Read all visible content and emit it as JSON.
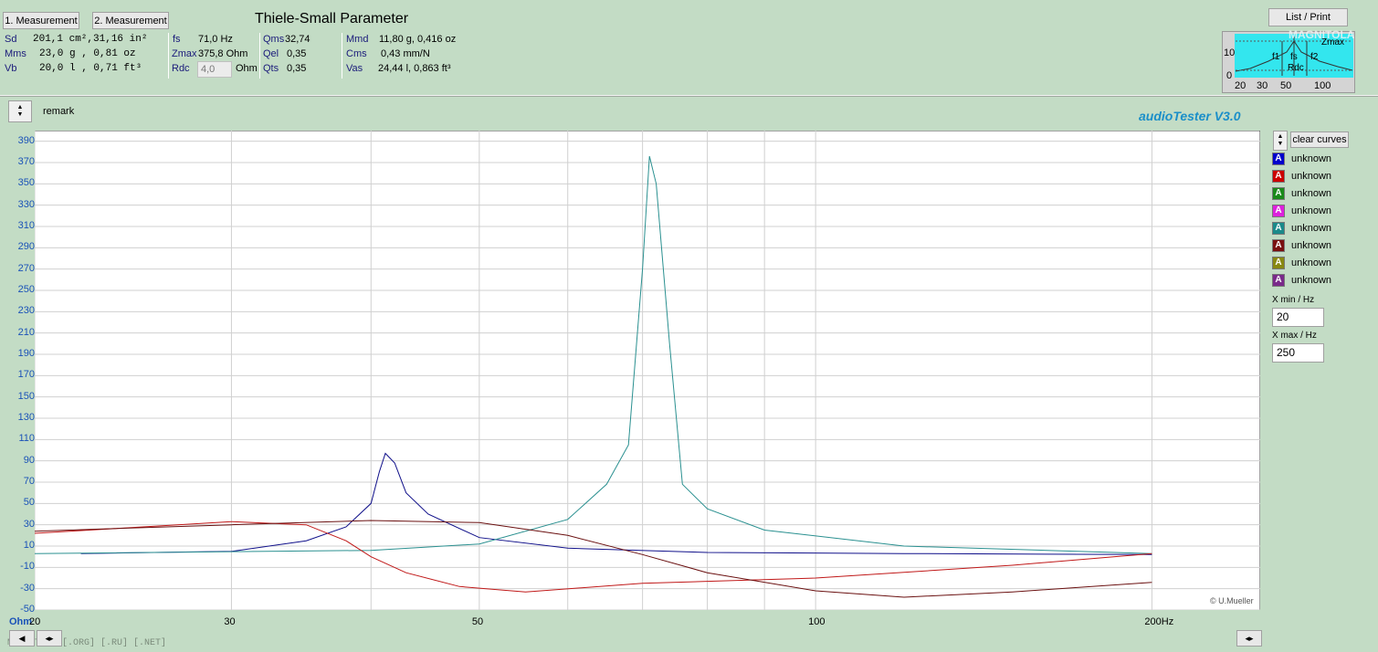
{
  "header": {
    "measurement1_label": "1. Measurement",
    "measurement2_label": "2. Measurement",
    "title": "Thiele-Small Parameter",
    "list_print_label": "List / Print"
  },
  "params": {
    "sd_label": "Sd",
    "sd_value": "201,1 cm²,31,16 in²",
    "mms_label": "Mms",
    "mms_value": "23,0 g  , 0,81 oz",
    "vb_label": "Vb",
    "vb_value": "20,0 l  , 0,71 ft³",
    "fs_label": "fs",
    "fs_value": "71,0 Hz",
    "zmax_label": "Zmax",
    "zmax_value": "375,8 Ohm",
    "rdc_label": "Rdc",
    "rdc_value": "4,0",
    "rdc_unit": "Ohm",
    "qms_label": "Qms",
    "qms_value": "32,74",
    "qel_label": "Qel",
    "qel_value": "0,35",
    "qts_label": "Qts",
    "qts_value": "0,35",
    "mmd_label": "Mmd",
    "mmd_value": "11,80 g, 0,416 oz",
    "cms_label": "Cms",
    "cms_value": "0,43 mm/N",
    "vas_label": "Vas",
    "vas_value": "24,44 l, 0,863 ft³"
  },
  "mini_preview": {
    "y10": "10",
    "y0": "0",
    "zmax": "Zmax",
    "f1": "f1",
    "fs": "fs",
    "f2": "f2",
    "rdc": "Rdc",
    "x_labels": [
      "20",
      "30",
      "50",
      "100"
    ],
    "watermark": "MAGNITOLA"
  },
  "toolbar": {
    "remark_label": "remark",
    "brand": "audioTester  V3.0"
  },
  "legend": {
    "clear_label": "clear curves",
    "items": [
      {
        "label": "unknown",
        "color": "#0000cc"
      },
      {
        "label": "unknown",
        "color": "#cc0000"
      },
      {
        "label": "unknown",
        "color": "#1a8a1a"
      },
      {
        "label": "unknown",
        "color": "#dd22dd"
      },
      {
        "label": "unknown",
        "color": "#1a8a8a"
      },
      {
        "label": "unknown",
        "color": "#7a1010"
      },
      {
        "label": "unknown",
        "color": "#888811"
      },
      {
        "label": "unknown",
        "color": "#7a2a8a"
      }
    ],
    "xmin_label": "X min / Hz",
    "xmin_value": "20",
    "xmax_label": "X max / Hz",
    "xmax_value": "250"
  },
  "footer": {
    "watermark": "MAGNITOLA [.ORG] [.RU] [.NET]",
    "copyright": "© U.Mueller"
  },
  "chart_data": {
    "type": "line",
    "ylabel": "Ohm",
    "xscale": "log",
    "xlim": [
      20,
      250
    ],
    "ylim": [
      -50,
      400
    ],
    "grid": true,
    "y_ticks": [
      390,
      370,
      350,
      330,
      310,
      290,
      270,
      250,
      230,
      210,
      190,
      170,
      150,
      130,
      110,
      90,
      70,
      50,
      30,
      10,
      -10,
      -30,
      -50
    ],
    "x_tick_labels": [
      {
        "value": 30,
        "label": "30"
      },
      {
        "value": 50,
        "label": "50"
      },
      {
        "value": 100,
        "label": "100"
      },
      {
        "value": 200,
        "label": "200Hz"
      }
    ],
    "x_gridlines": [
      20,
      30,
      40,
      50,
      60,
      70,
      80,
      90,
      100,
      200
    ],
    "y_axis_corner_labels": {
      "unit": "Ohm",
      "x_start": "20"
    },
    "series": [
      {
        "color": "#10108a",
        "x": [
          22,
          30,
          35,
          38,
          40,
          40.7,
          41.2,
          42,
          43,
          45,
          50,
          60,
          80,
          120,
          200
        ],
        "y": [
          3,
          5,
          15,
          28,
          50,
          80,
          97,
          88,
          60,
          40,
          18,
          8,
          4,
          3,
          2
        ]
      },
      {
        "color": "#2a9090",
        "x": [
          20,
          40,
          50,
          60,
          65,
          68,
          70,
          71,
          72,
          74,
          76,
          80,
          90,
          120,
          200
        ],
        "y": [
          3,
          6,
          12,
          35,
          68,
          105,
          270,
          376,
          350,
          200,
          68,
          45,
          25,
          10,
          3
        ]
      },
      {
        "color": "#c01818",
        "x": [
          20,
          25,
          30,
          35,
          38,
          40,
          43,
          48,
          55,
          70,
          100,
          150,
          200
        ],
        "y": [
          22,
          28,
          33,
          30,
          15,
          0,
          -15,
          -28,
          -33,
          -25,
          -20,
          -8,
          3
        ]
      },
      {
        "color": "#6a1010",
        "x": [
          20,
          30,
          40,
          50,
          60,
          70,
          80,
          100,
          120,
          150,
          200
        ],
        "y": [
          24,
          30,
          34,
          32,
          20,
          2,
          -15,
          -32,
          -38,
          -33,
          -24
        ]
      }
    ]
  }
}
